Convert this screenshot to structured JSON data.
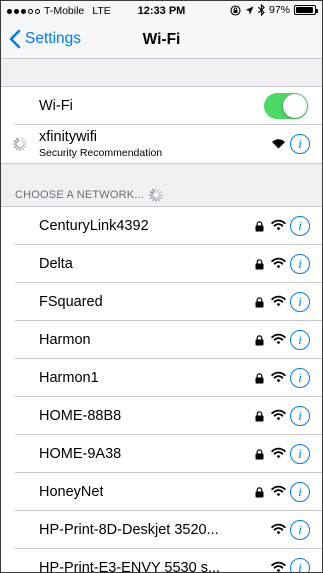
{
  "status_bar": {
    "carrier": "T-Mobile",
    "network_type": "LTE",
    "time": "12:33 PM",
    "battery_percent": "97%",
    "battery_level": 0.97,
    "signal_bars": 3,
    "signal_total": 5,
    "icons": [
      "rotation-lock-icon",
      "location-icon",
      "bluetooth-icon",
      "battery-icon"
    ]
  },
  "nav": {
    "back_label": "Settings",
    "title": "Wi-Fi"
  },
  "wifi_toggle": {
    "label": "Wi-Fi",
    "on": true
  },
  "current_network": {
    "name": "xfinitywifi",
    "subtitle": "Security Recommendation"
  },
  "section_header": "CHOOSE A NETWORK...",
  "networks": [
    {
      "name": "CenturyLink4392",
      "locked": true
    },
    {
      "name": "Delta",
      "locked": true
    },
    {
      "name": "FSquared",
      "locked": true
    },
    {
      "name": "Harmon",
      "locked": true
    },
    {
      "name": "Harmon1",
      "locked": true
    },
    {
      "name": "HOME-88B8",
      "locked": true
    },
    {
      "name": "HOME-9A38",
      "locked": true
    },
    {
      "name": "HoneyNet",
      "locked": true
    },
    {
      "name": "HP-Print-8D-Deskjet 3520...",
      "locked": false
    },
    {
      "name": "HP-Print-E3-ENVY 5530 s...",
      "locked": false
    }
  ],
  "colors": {
    "accent": "#007aff",
    "toggle_on": "#4cd964",
    "background": "#efeff4",
    "separator": "#c8c7cc",
    "header_text": "#6d6d72"
  }
}
